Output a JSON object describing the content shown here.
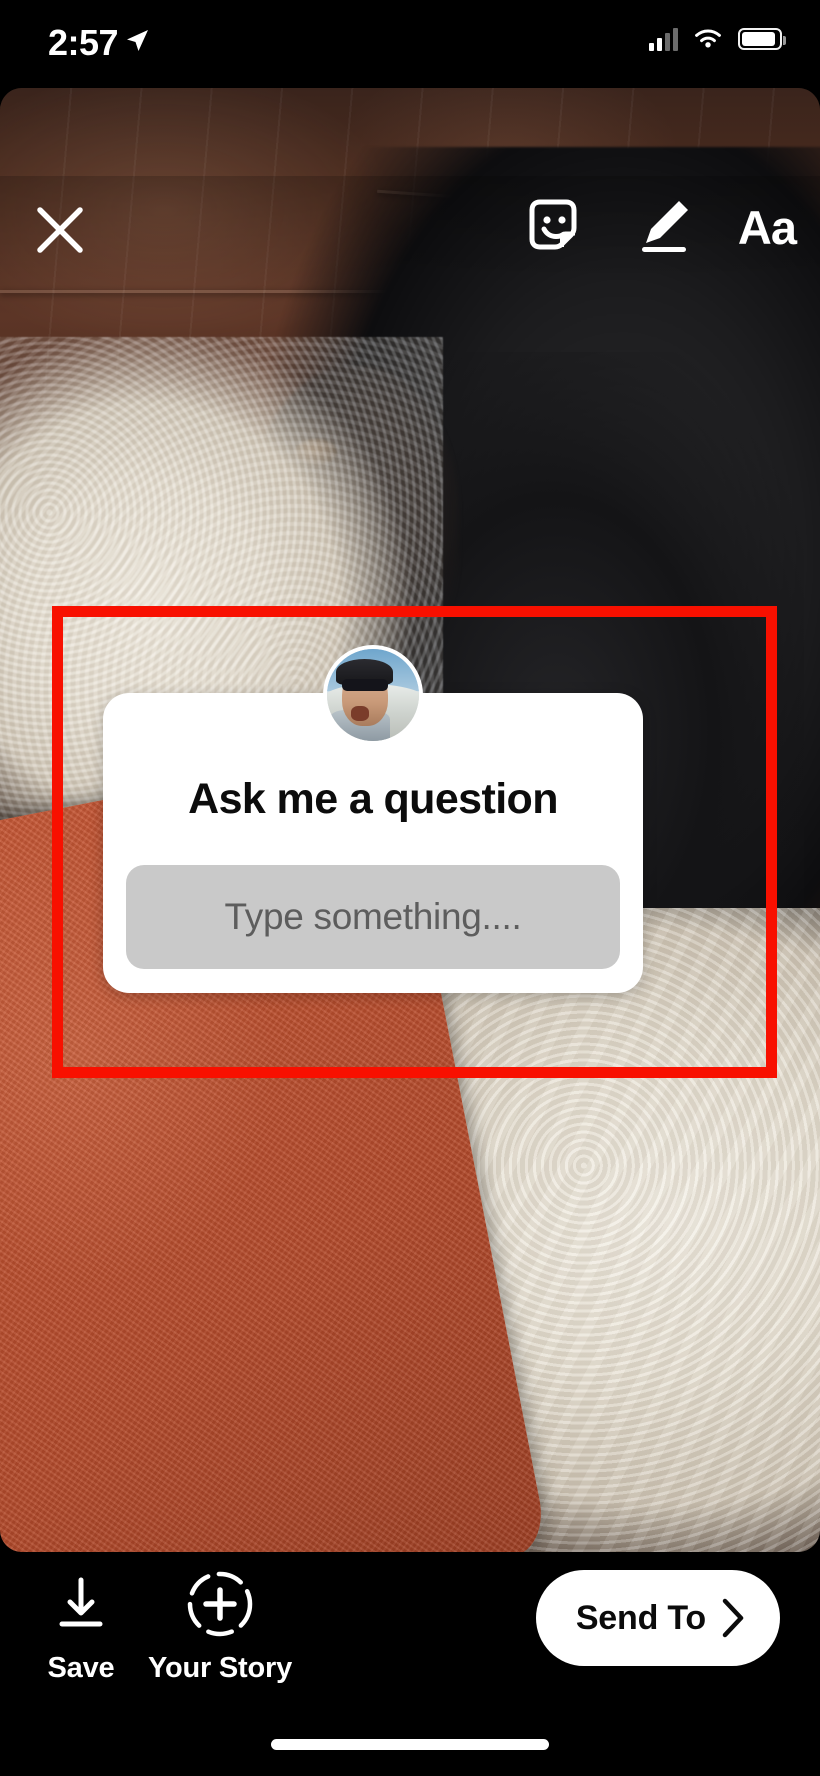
{
  "app": "instagram-story-editor",
  "status_bar": {
    "time": "2:57",
    "location_icon": "location-arrow-icon",
    "cellular_icon": "cellular-signal-icon",
    "wifi_icon": "wifi-icon",
    "battery_icon": "battery-icon"
  },
  "toolbar": {
    "close_icon": "close-icon",
    "sticker_icon": "sticker-icon",
    "draw_icon": "pen-draw-icon",
    "text_label": "Aa"
  },
  "sticker": {
    "avatar_name": "profile-avatar",
    "title": "Ask me a question",
    "input_placeholder": "Type something....",
    "input_value": "",
    "card_color": "#ffffff",
    "input_color": "#c9c9c9",
    "placeholder_color": "#5d5d5d"
  },
  "annotation": {
    "color": "#f81000",
    "shape": "rectangle-highlight"
  },
  "bottom_bar": {
    "save_label": "Save",
    "save_icon": "download-arrow-icon",
    "story_label": "Your Story",
    "story_icon": "add-to-story-icon",
    "send_to_label": "Send To",
    "send_to_icon": "chevron-right-icon"
  }
}
